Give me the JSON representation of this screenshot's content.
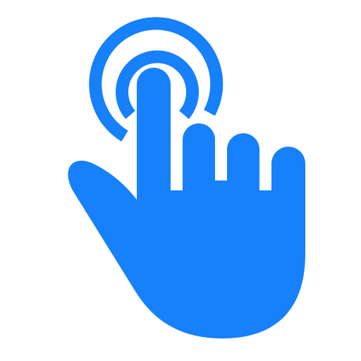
{
  "icon": {
    "name": "tap-gesture-icon",
    "color": "#1780FB",
    "background": "#FFFFFF"
  }
}
